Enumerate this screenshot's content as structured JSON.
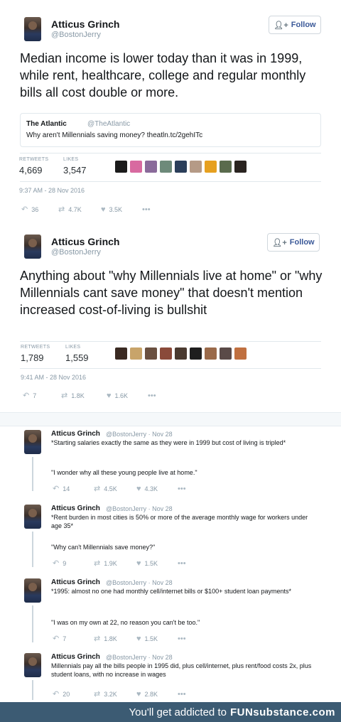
{
  "tweets": [
    {
      "name": "Atticus Grinch",
      "handle": "@BostonJerry",
      "follow_label": "Follow",
      "text": "Median income is lower today than it was in 1999, while rent, healthcare, college and regular monthly bills all cost double or more.",
      "quote": {
        "name": "The Atlantic",
        "handle": "@TheAtlantic",
        "text": "Why aren't Millennials saving money? theatln.tc/2gehITc"
      },
      "retweets_label": "RETWEETS",
      "likes_label": "LIKES",
      "retweets": "4,669",
      "likes": "3,547",
      "timestamp": "9:37 AM - 28 Nov 2016",
      "replies": "36",
      "rt_count": "4.7K",
      "like_count": "3.5K",
      "more": "•••"
    },
    {
      "name": "Atticus Grinch",
      "handle": "@BostonJerry",
      "follow_label": "Follow",
      "text": "Anything about \"why Millennials live at home\" or \"why Millennials cant save money\" that doesn't mention increased cost-of-living is bullshit",
      "retweets_label": "RETWEETS",
      "likes_label": "LIKES",
      "retweets": "1,789",
      "likes": "1,559",
      "timestamp": "9:41 AM - 28 Nov 2016",
      "replies": "7",
      "rt_count": "1.8K",
      "like_count": "1.6K",
      "more": "•••"
    }
  ],
  "thread": [
    {
      "name": "Atticus Grinch",
      "meta": "@BostonJerry · Nov 28",
      "text": "*Starting salaries exactly the same as they were in 1999 but cost of living is tripled*",
      "text2": "\"I wonder why all these young people live at home.\"",
      "replies": "14",
      "rts": "4.5K",
      "likes": "4.3K",
      "more": "•••"
    },
    {
      "name": "Atticus Grinch",
      "meta": "@BostonJerry · Nov 28",
      "text": "*Rent burden in most cities is 50% or more of the average monthly wage for workers under age 35*",
      "text2": "\"Why can't Millennials save money?\"",
      "replies": "9",
      "rts": "1.9K",
      "likes": "1.5K",
      "more": "•••"
    },
    {
      "name": "Atticus Grinch",
      "meta": "@BostonJerry · Nov 28",
      "text": "*1995: almost no one had monthly cell/internet bills or $100+ student loan payments*",
      "text2": "\"I was on my own at 22, no reason you can't be too.\"",
      "replies": "7",
      "rts": "1.8K",
      "likes": "1.5K",
      "more": "•••"
    },
    {
      "name": "Atticus Grinch",
      "meta": "@BostonJerry · Nov 28",
      "text": "Millennials pay all the bills people in 1995 did, plus cell/internet, plus rent/food costs 2x, plus student loans, with no increase in wages",
      "replies": "20",
      "rts": "3.2K",
      "likes": "2.8K",
      "more": "•••"
    }
  ],
  "footer": {
    "text": "You'll get addicted to",
    "brand": "FUNsubstance.com"
  },
  "colors": {
    "footer_bg": "#3c5b73",
    "follow_text": "#3b5998",
    "muted": "#8899a6"
  },
  "icons": [
    "reply-icon",
    "retweet-icon",
    "heart-icon",
    "more-icon",
    "follow-person-icon"
  ]
}
